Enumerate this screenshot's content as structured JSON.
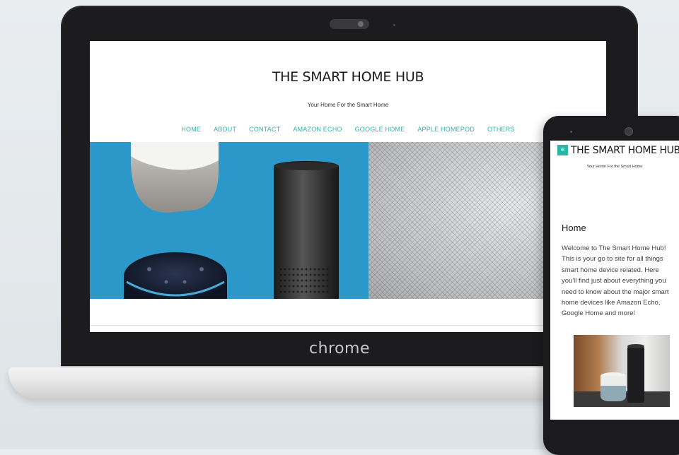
{
  "laptop": {
    "brand": "chrome",
    "site": {
      "title": "THE SMART HOME HUB",
      "tagline": "Your Home For the Smart Home",
      "nav": [
        "HOME",
        "ABOUT",
        "CONTACT",
        "AMAZON ECHO",
        "GOOGLE HOME",
        "APPLE HOMEPOD",
        "OTHERS"
      ]
    }
  },
  "phone": {
    "menu_icon": "hamburger-icon",
    "title": "THE SMART HOME HUB",
    "tagline": "Your Home For the Smart Home",
    "heading": "Home",
    "body": "Welcome to The Smart Home Hub! This is your go to site for all things smart home device related. Here you'll find just about everything you need to know about the major smart home devices like Amazon Echo, Google Home and more!"
  },
  "colors": {
    "accent": "#2bb5a9",
    "hero_blue": "#2b98c9",
    "device_frame": "#1c1c1e"
  }
}
